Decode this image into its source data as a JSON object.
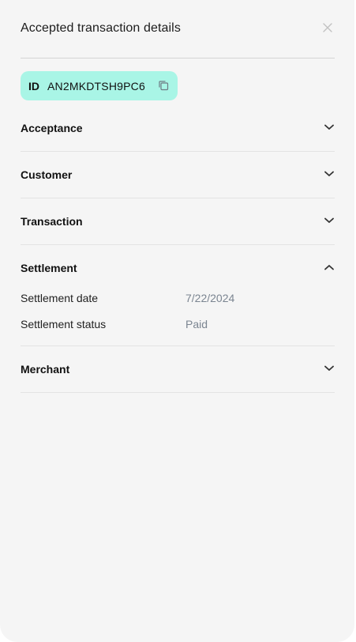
{
  "panel": {
    "title": "Accepted transaction details",
    "close_icon": "close-icon"
  },
  "id_chip": {
    "label": "ID",
    "value": "AN2MKDTSH9PC6",
    "copy_icon": "copy-icon",
    "color": "#a9f5e6"
  },
  "sections": {
    "acceptance": {
      "title": "Acceptance",
      "expanded": false
    },
    "customer": {
      "title": "Customer",
      "expanded": false
    },
    "transaction": {
      "title": "Transaction",
      "expanded": false
    },
    "settlement": {
      "title": "Settlement",
      "expanded": true,
      "rows": [
        {
          "label": "Settlement date",
          "value": "7/22/2024"
        },
        {
          "label": "Settlement status",
          "value": "Paid"
        }
      ]
    },
    "merchant": {
      "title": "Merchant",
      "expanded": false
    }
  },
  "colors": {
    "background": "#f5f5f5",
    "muted_value": "#7b8591"
  }
}
